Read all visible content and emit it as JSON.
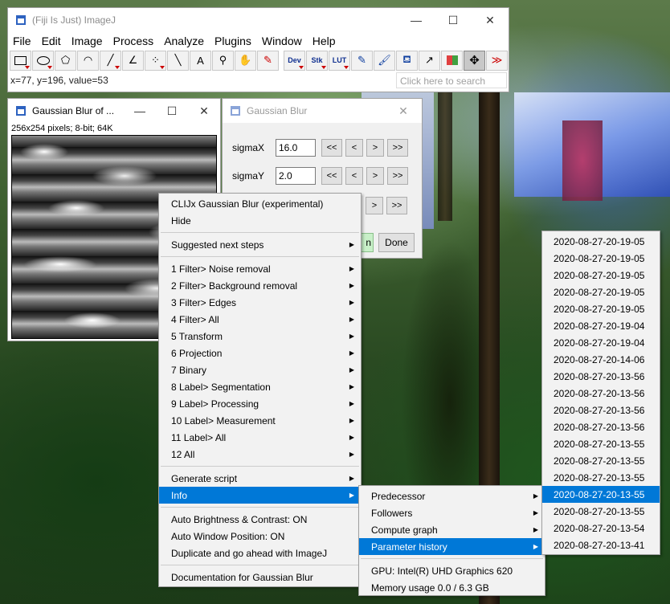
{
  "main_window": {
    "title": "(Fiji Is Just) ImageJ",
    "min_symbol": "—",
    "max_symbol": "☐",
    "close_symbol": "✕",
    "menus": [
      "File",
      "Edit",
      "Image",
      "Process",
      "Analyze",
      "Plugins",
      "Window",
      "Help"
    ],
    "tools": {
      "dev": "Dev",
      "stk": "Stk",
      "lut": "LUT",
      "more": "≫"
    },
    "status_text": "x=77, y=196, value=53",
    "search_placeholder": "Click here to search"
  },
  "image_window": {
    "title": "Gaussian Blur of ...",
    "info": "256x254 pixels; 8-bit; 64K"
  },
  "dialog": {
    "title": "Gaussian Blur",
    "sigma_x_label": "sigmaX",
    "sigma_x_value": "16.0",
    "sigma_y_label": "sigmaY",
    "sigma_y_value": "2.0",
    "btn_dbl_left": "<<",
    "btn_left": "<",
    "btn_right": ">",
    "btn_dbl_right": ">>",
    "partial_button": "n",
    "done_label": "Done"
  },
  "context_menu": {
    "items": [
      "CLIJx Gaussian Blur (experimental)",
      "Hide",
      "Suggested next steps",
      "1 Filter> Noise removal",
      "2 Filter> Background removal",
      "3 Filter> Edges",
      "4 Filter> All",
      "5 Transform",
      "6 Projection",
      "7 Binary",
      "8 Label> Segmentation",
      "9 Label> Processing",
      "10 Label> Measurement",
      "11 Label> All",
      "12 All",
      "Generate script",
      "Info",
      "Auto Brightness & Contrast: ON",
      "Auto Window Position: ON",
      "Duplicate and go ahead with ImageJ",
      "Documentation for Gaussian Blur"
    ]
  },
  "info_submenu": {
    "items": [
      "Predecessor",
      "Followers",
      "Compute graph",
      "Parameter history",
      "GPU: Intel(R) UHD Graphics 620",
      "Memory usage 0.0 / 6.3 GB"
    ]
  },
  "history_submenu": {
    "items": [
      "2020-08-27-20-19-05",
      "2020-08-27-20-19-05",
      "2020-08-27-20-19-05",
      "2020-08-27-20-19-05",
      "2020-08-27-20-19-05",
      "2020-08-27-20-19-04",
      "2020-08-27-20-19-04",
      "2020-08-27-20-14-06",
      "2020-08-27-20-13-56",
      "2020-08-27-20-13-56",
      "2020-08-27-20-13-56",
      "2020-08-27-20-13-56",
      "2020-08-27-20-13-55",
      "2020-08-27-20-13-55",
      "2020-08-27-20-13-55",
      "2020-08-27-20-13-55",
      "2020-08-27-20-13-55",
      "2020-08-27-20-13-54",
      "2020-08-27-20-13-41"
    ]
  }
}
